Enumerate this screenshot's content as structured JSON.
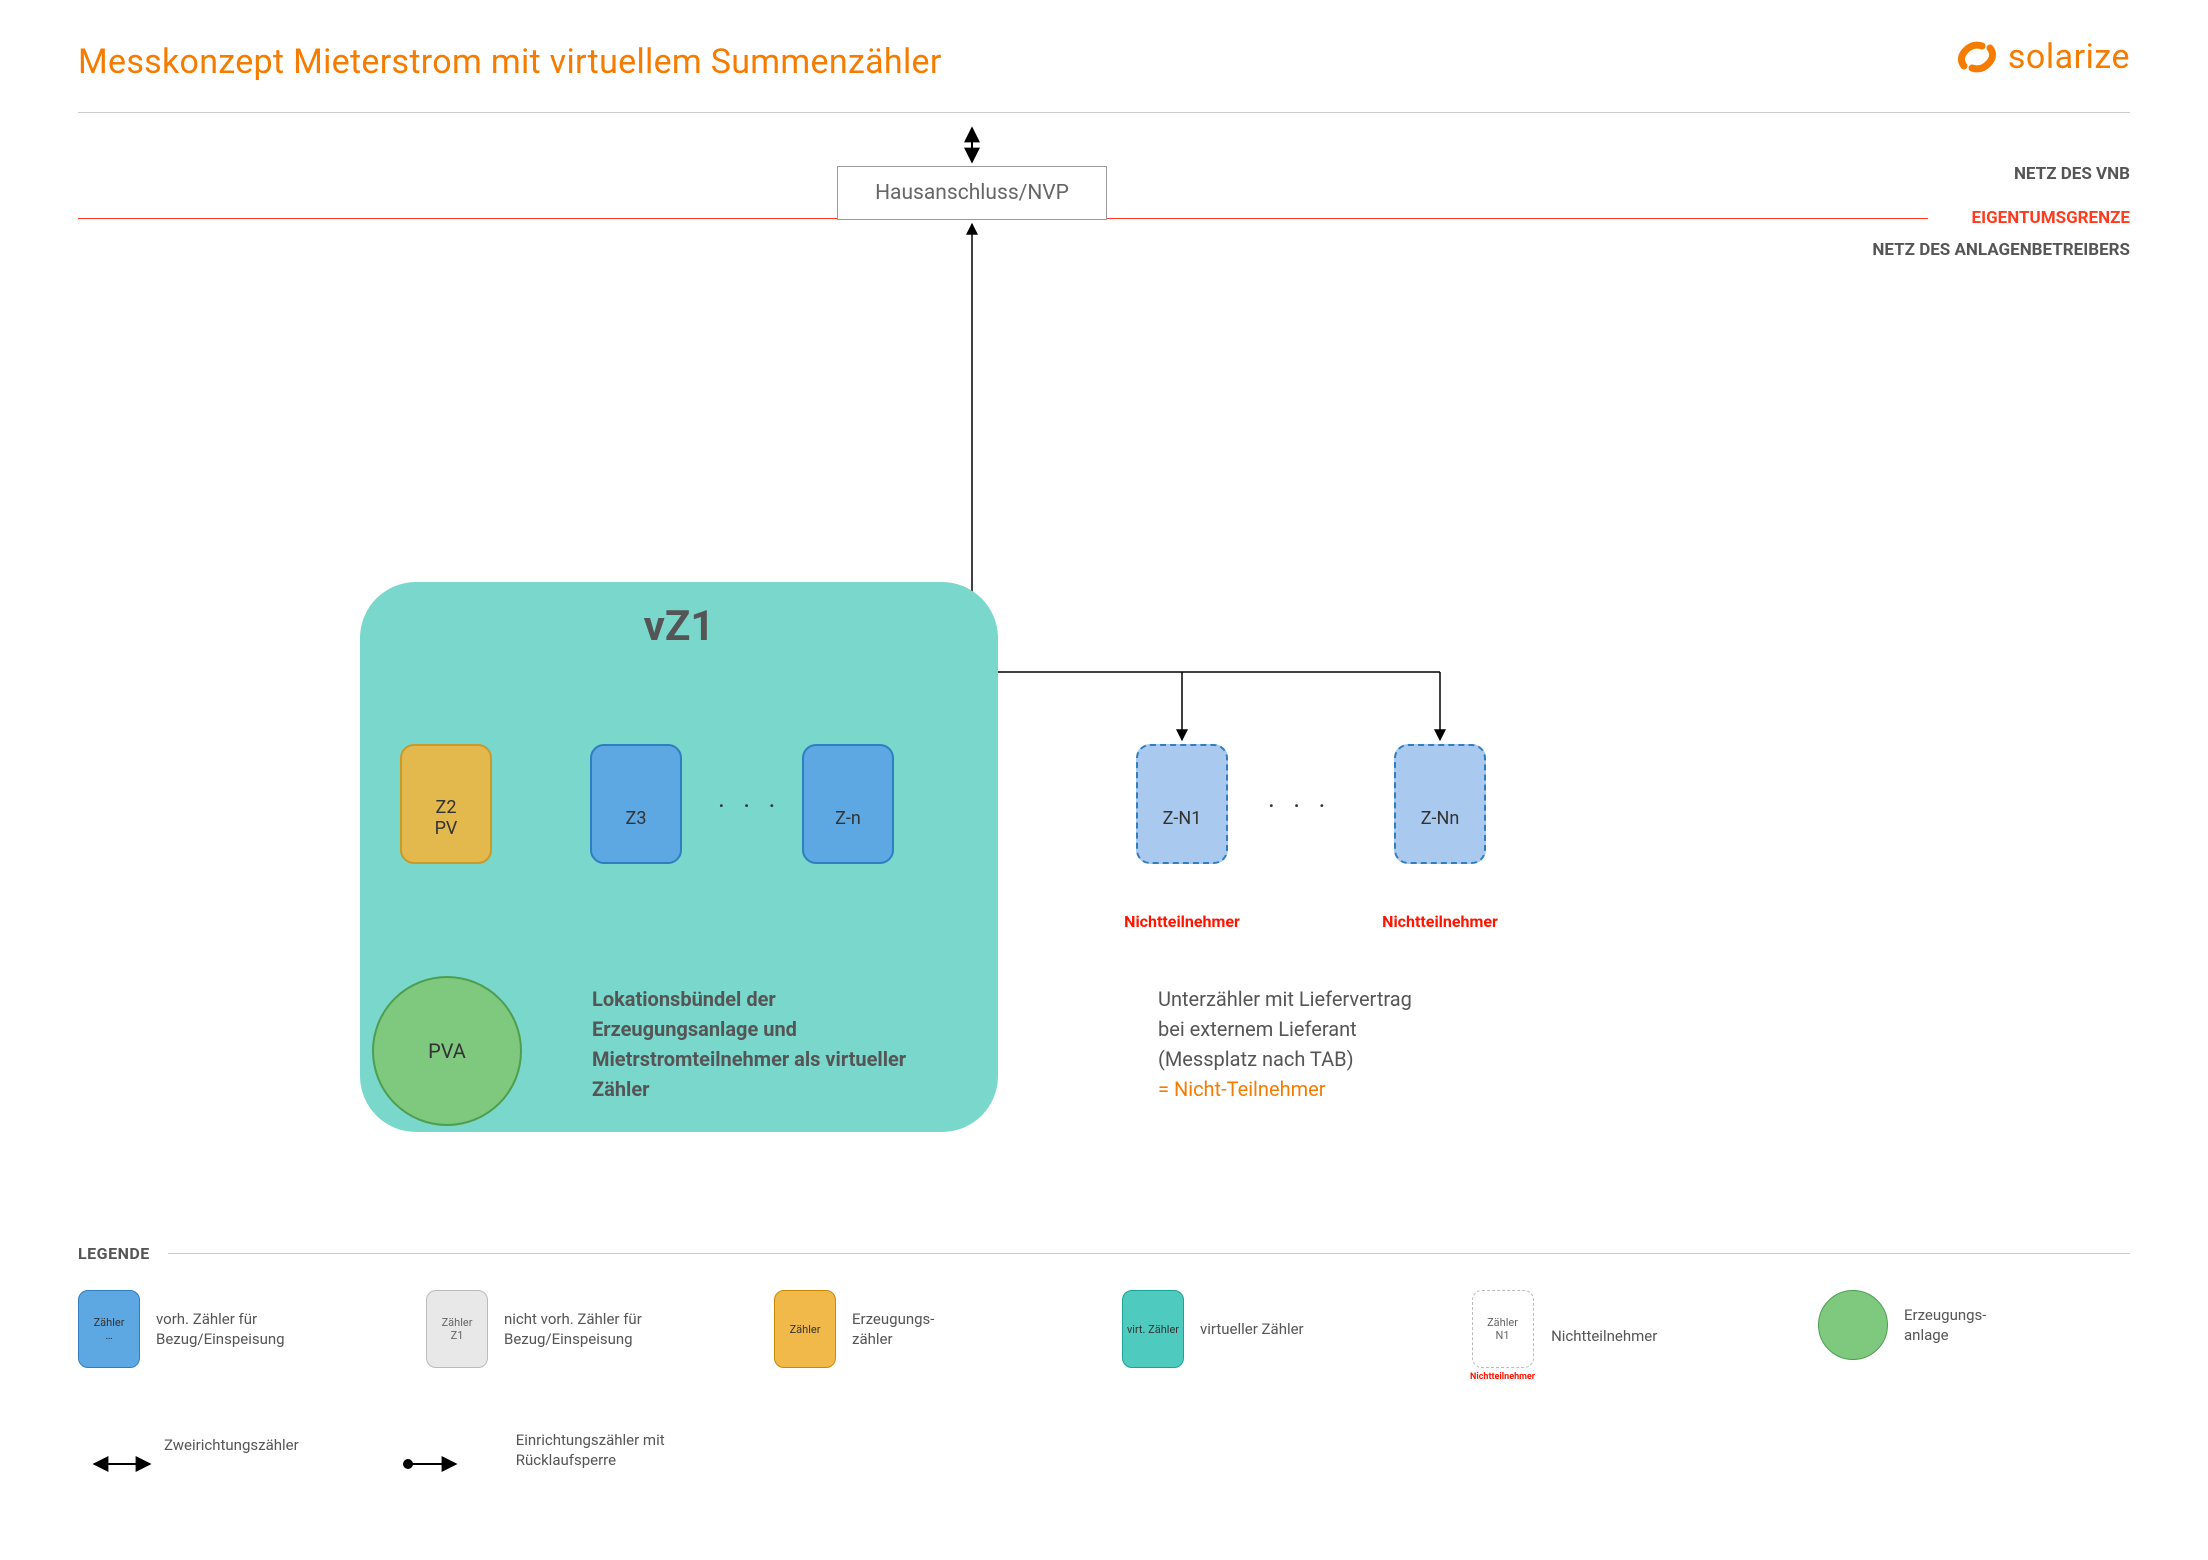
{
  "title": "Messkonzept Mieterstrom mit virtuellem Summenzähler",
  "brand": "solarize",
  "nvp": "Hausanschluss/NVP",
  "side": {
    "vnb": "NETZ DES VNB",
    "eig": "EIGENTUMSGRENZE",
    "anl": "NETZ DES ANLAGENBETREIBERS"
  },
  "vz": {
    "title": "vZ1",
    "z2_line1": "Z2",
    "z2_line2": "PV",
    "z3": "Z3",
    "zn": "Z-n",
    "pva": "PVA",
    "desc": "Lokationsbündel der Erzeugungsanlage und Mietrstromteilnehmer als virtueller Zähler"
  },
  "nt": {
    "zn1": "Z-N1",
    "znn": "Z-Nn",
    "label": "Nichtteilnehmer",
    "desc_l1": "Unterzähler mit Liefervertrag",
    "desc_l2": "bei externem Lieferant",
    "desc_l3": "(Messplatz nach TAB)",
    "desc_l4": "= Nicht-Teilnehmer"
  },
  "dots": "· · ·",
  "legend": {
    "header": "LEGENDE",
    "items": [
      {
        "box": "Zähler\n…",
        "text": "vorh. Zähler für Bezug/Einspeisung"
      },
      {
        "box": "Zähler\nZ1",
        "text": "nicht vorh. Zähler für Bezug/Einspeisung"
      },
      {
        "box": "Zähler",
        "text": "Erzeugungs-\nzähler"
      },
      {
        "box": "virt. Zähler",
        "text": "virtueller Zähler"
      },
      {
        "box": "Zähler\nN1",
        "sub": "Nichtteilnehmer",
        "text": "Nichtteilnehmer"
      },
      {
        "text": "Erzeugungs-\nanlage"
      }
    ],
    "row2": [
      {
        "text": "Zweirichtungszähler"
      },
      {
        "text": "Einrichtungszähler mit Rücklaufsperre"
      }
    ]
  }
}
